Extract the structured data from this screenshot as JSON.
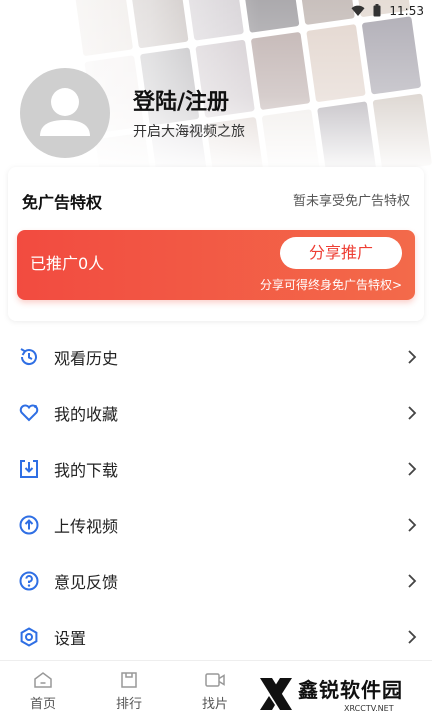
{
  "status_bar": {
    "time": "11:53"
  },
  "header": {
    "title": "登陆/注册",
    "subtitle": "开启大海视频之旅"
  },
  "ad_free": {
    "title": "免广告特权",
    "status": "暂未享受免广告特权",
    "promo_count": "已推广0人",
    "share_button": "分享推广",
    "promo_note": "分享可得终身免广告特权>"
  },
  "menu": [
    {
      "label": "观看历史",
      "icon": "history-icon"
    },
    {
      "label": "我的收藏",
      "icon": "heart-icon"
    },
    {
      "label": "我的下载",
      "icon": "download-icon"
    },
    {
      "label": "上传视频",
      "icon": "upload-icon"
    },
    {
      "label": "意见反馈",
      "icon": "question-icon"
    },
    {
      "label": "设置",
      "icon": "settings-icon"
    }
  ],
  "bottom_nav": [
    {
      "label": "首页",
      "icon": "home-icon"
    },
    {
      "label": "排行",
      "icon": "ranking-icon"
    },
    {
      "label": "找片",
      "icon": "video-search-icon"
    }
  ],
  "watermark": {
    "text": "鑫锐软件园",
    "sub": "XRCCTV.NET"
  },
  "colors": {
    "accent": "#ee3e34",
    "icon_blue": "#2f6fe4"
  }
}
